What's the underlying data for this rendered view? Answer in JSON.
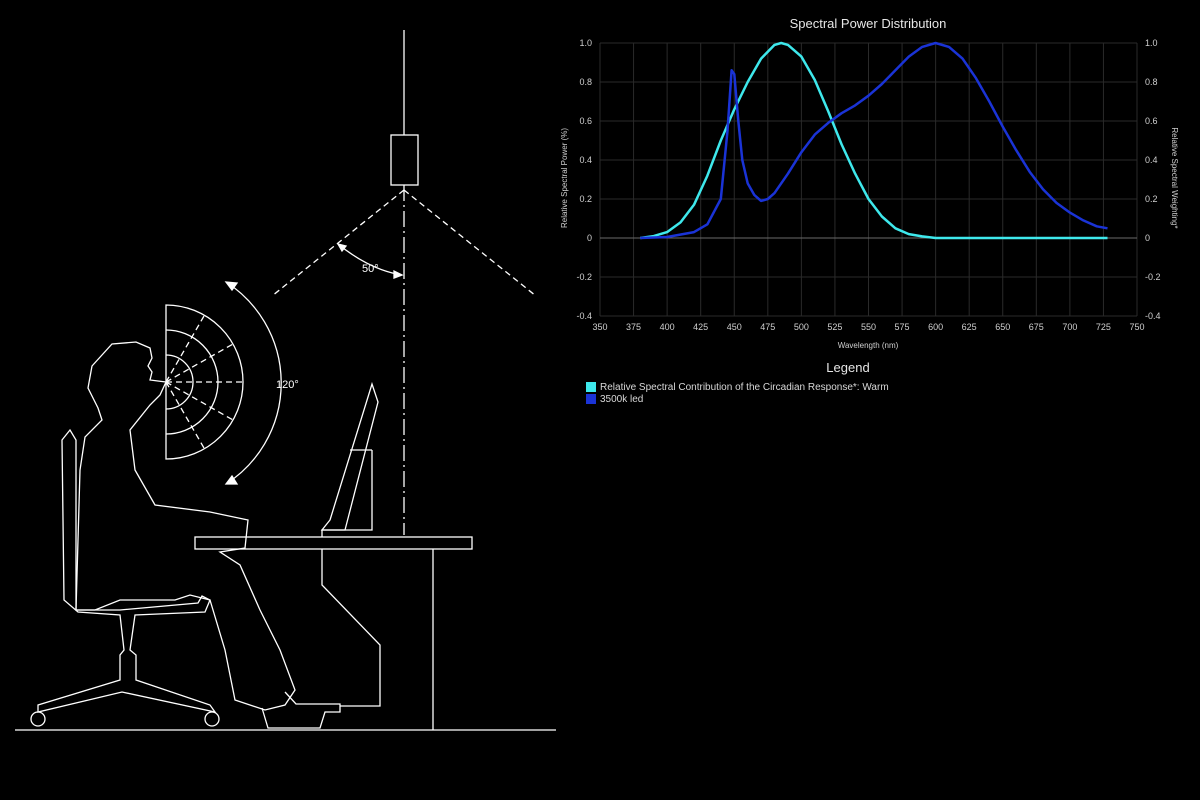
{
  "illustration": {
    "angle_top_label": "50°",
    "angle_view_label": "120°"
  },
  "chart_data": {
    "type": "line",
    "title": "Spectral Power Distribution",
    "xlabel": "Wavelength (nm)",
    "ylabel_left": "Relative Spectral Power (%)",
    "ylabel_right": "Relative Spectral Weighting*",
    "xlim": [
      350,
      750
    ],
    "ylim": [
      -0.4,
      1.0
    ],
    "x_ticks": [
      "350",
      "375",
      "400",
      "425",
      "450",
      "475",
      "500",
      "525",
      "550",
      "575",
      "600",
      "625",
      "650",
      "675",
      "700",
      "725",
      "750"
    ],
    "y_ticks": [
      "1.0",
      "0.8",
      "0.6",
      "0.4",
      "0.2",
      "0",
      "-0.2",
      "-0.4"
    ],
    "grid": true,
    "legend_title": "Legend",
    "legend_placement": "bottom",
    "series": [
      {
        "name": "Relative Spectral Contribution of the Circadian Response*: Warm",
        "color": "#3ee8ec",
        "points": [
          [
            380,
            0.0
          ],
          [
            390,
            0.01
          ],
          [
            400,
            0.03
          ],
          [
            410,
            0.08
          ],
          [
            420,
            0.17
          ],
          [
            430,
            0.32
          ],
          [
            440,
            0.5
          ],
          [
            450,
            0.66
          ],
          [
            460,
            0.8
          ],
          [
            470,
            0.92
          ],
          [
            480,
            0.99
          ],
          [
            485,
            1.0
          ],
          [
            490,
            0.99
          ],
          [
            500,
            0.93
          ],
          [
            510,
            0.81
          ],
          [
            520,
            0.65
          ],
          [
            530,
            0.48
          ],
          [
            540,
            0.33
          ],
          [
            550,
            0.2
          ],
          [
            560,
            0.11
          ],
          [
            570,
            0.05
          ],
          [
            580,
            0.02
          ],
          [
            590,
            0.008
          ],
          [
            600,
            0.0
          ],
          [
            625,
            0.0
          ],
          [
            650,
            0.0
          ],
          [
            700,
            0.0
          ],
          [
            728,
            0.0
          ]
        ]
      },
      {
        "name": "3500k led",
        "color": "#1a33d6",
        "points": [
          [
            380,
            0.0
          ],
          [
            400,
            0.005
          ],
          [
            420,
            0.03
          ],
          [
            430,
            0.07
          ],
          [
            440,
            0.2
          ],
          [
            445,
            0.55
          ],
          [
            448,
            0.86
          ],
          [
            450,
            0.84
          ],
          [
            453,
            0.6
          ],
          [
            456,
            0.4
          ],
          [
            460,
            0.28
          ],
          [
            465,
            0.22
          ],
          [
            470,
            0.19
          ],
          [
            475,
            0.2
          ],
          [
            480,
            0.23
          ],
          [
            490,
            0.33
          ],
          [
            500,
            0.44
          ],
          [
            510,
            0.53
          ],
          [
            520,
            0.59
          ],
          [
            530,
            0.64
          ],
          [
            540,
            0.68
          ],
          [
            550,
            0.73
          ],
          [
            560,
            0.79
          ],
          [
            570,
            0.86
          ],
          [
            580,
            0.93
          ],
          [
            590,
            0.98
          ],
          [
            600,
            1.0
          ],
          [
            610,
            0.98
          ],
          [
            620,
            0.92
          ],
          [
            630,
            0.82
          ],
          [
            640,
            0.7
          ],
          [
            650,
            0.57
          ],
          [
            660,
            0.45
          ],
          [
            670,
            0.34
          ],
          [
            680,
            0.25
          ],
          [
            690,
            0.18
          ],
          [
            700,
            0.13
          ],
          [
            710,
            0.09
          ],
          [
            720,
            0.06
          ],
          [
            728,
            0.05
          ]
        ]
      }
    ]
  }
}
